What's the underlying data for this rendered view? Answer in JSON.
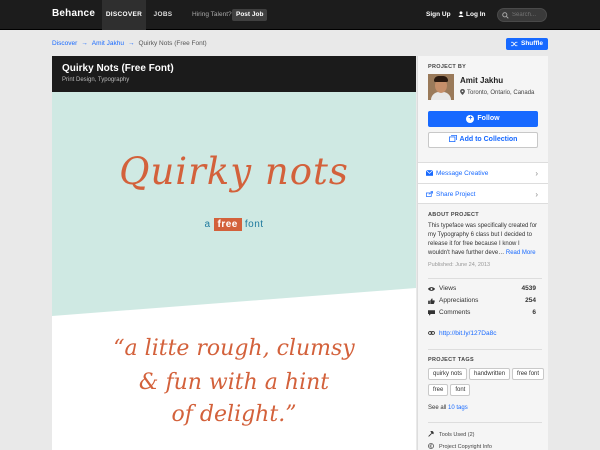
{
  "topbar": {
    "logo": "Behance",
    "tabs": [
      {
        "label": "DISCOVER",
        "active": true
      },
      {
        "label": "JOBS",
        "active": false
      }
    ],
    "hiring_text": "Hiring Talent?",
    "post_job_label": "Post Job",
    "signup_label": "Sign Up",
    "login_label": "Log In",
    "search_placeholder": "Search..."
  },
  "breadcrumb": {
    "items": [
      "Discover",
      "Amit Jakhu",
      "Quirky Nots (Free Font)"
    ],
    "separator": "→"
  },
  "shuffle_label": "Shuffle",
  "project": {
    "title": "Quirky Nots (Free Font)",
    "fields": "Print Design, Typography",
    "art": {
      "headline": "Quirky nots",
      "sub_a": "a",
      "sub_free": "free",
      "sub_font": "font",
      "quote_lines": [
        "“a litte rough, clumsy",
        "& fun with a hint",
        "of delight.”"
      ],
      "teal_color": "#cfe9e3",
      "accent_color": "#d3613b",
      "blue_color": "#1f7a9e"
    }
  },
  "sidebar": {
    "project_by_label": "PROJECT BY",
    "owner": {
      "name": "Amit Jakhu",
      "location": "Toronto, Ontario, Canada"
    },
    "follow_label": "Follow",
    "add_collection_label": "Add to Collection",
    "actions": [
      {
        "label": "Message Creative",
        "icon": "envelope-icon"
      },
      {
        "label": "Share Project",
        "icon": "share-icon"
      }
    ],
    "about_label": "ABOUT PROJECT",
    "about_text": "This typeface was specifically created for my Typography 6 class but I decided to release it for free because I know I wouldn't have further deve…",
    "about_more": "Read More",
    "published": "Published: June 24, 2013",
    "stats": [
      {
        "name": "Views",
        "value": "4539",
        "icon": "eye-icon"
      },
      {
        "name": "Appreciations",
        "value": "254",
        "icon": "thumbs-up-icon"
      },
      {
        "name": "Comments",
        "value": "6",
        "icon": "comment-icon"
      }
    ],
    "short_link": "http://bit.ly/127Da8c",
    "tags_label": "PROJECT TAGS",
    "tags": [
      "quirky nots",
      "handwritten",
      "free font",
      "free",
      "font"
    ],
    "see_all_prefix": "See all",
    "see_all_link": "10 tags",
    "tools_used": "Tools Used (2)",
    "copyright": "Project Copyright Info",
    "accent_blue": "#1769ff"
  }
}
